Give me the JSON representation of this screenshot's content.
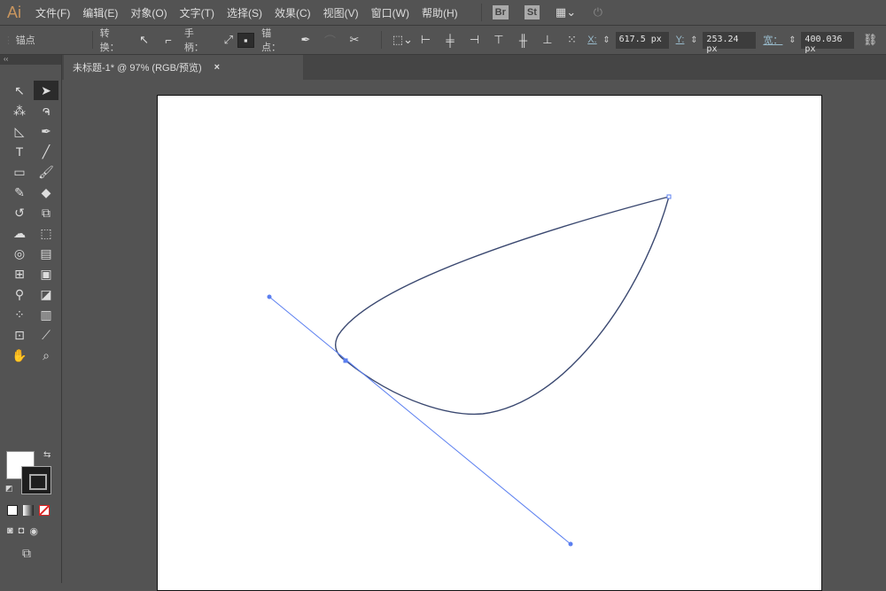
{
  "app": {
    "logo": "Ai"
  },
  "menu": [
    "文件(F)",
    "编辑(E)",
    "对象(O)",
    "文字(T)",
    "选择(S)",
    "效果(C)",
    "视图(V)",
    "窗口(W)",
    "帮助(H)"
  ],
  "bridge": [
    "Br",
    "St"
  ],
  "control": {
    "mode": "锚点",
    "convert": "转换：",
    "handles": "手柄：",
    "anchors": "锚点：",
    "x_label": "X:",
    "x": "617.5 px",
    "y_label": "Y:",
    "y": "253.24 px",
    "w_label": "宽：",
    "w": "400.036 px"
  },
  "document": {
    "tab": "未标题-1* @ 97% (RGB/预览)",
    "close": "×"
  },
  "toolbar": {
    "collapse": "‹‹"
  },
  "colors": {
    "path": "#4a6fd8",
    "canvas": "#535353"
  }
}
